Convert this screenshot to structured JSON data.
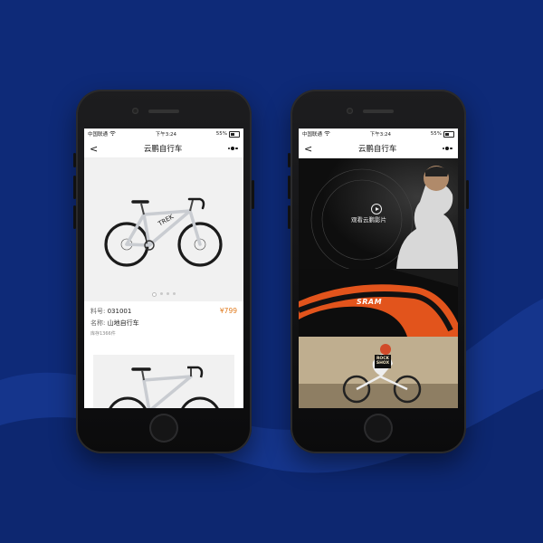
{
  "status_bar": {
    "carrier": "中国联通",
    "time": "下午3:24",
    "battery": "55%"
  },
  "nav": {
    "title": "云鹏自行车",
    "back_symbol": "<"
  },
  "left_screen": {
    "carousel_total": 4,
    "carousel_active": 0,
    "item_number_label": "料号:",
    "item_number": "031001",
    "name_label": "名称:",
    "name": "山地自行车",
    "stock": "库存1366件",
    "price": "¥799"
  },
  "right_screen": {
    "video_label": "观看云鹏影片",
    "sram_logo": "SRAM",
    "rockshox_logo": "ROCK SHOX"
  },
  "colors": {
    "background": "#0e2a78",
    "price": "#e07a1d",
    "accent_orange": "#e2541c"
  }
}
